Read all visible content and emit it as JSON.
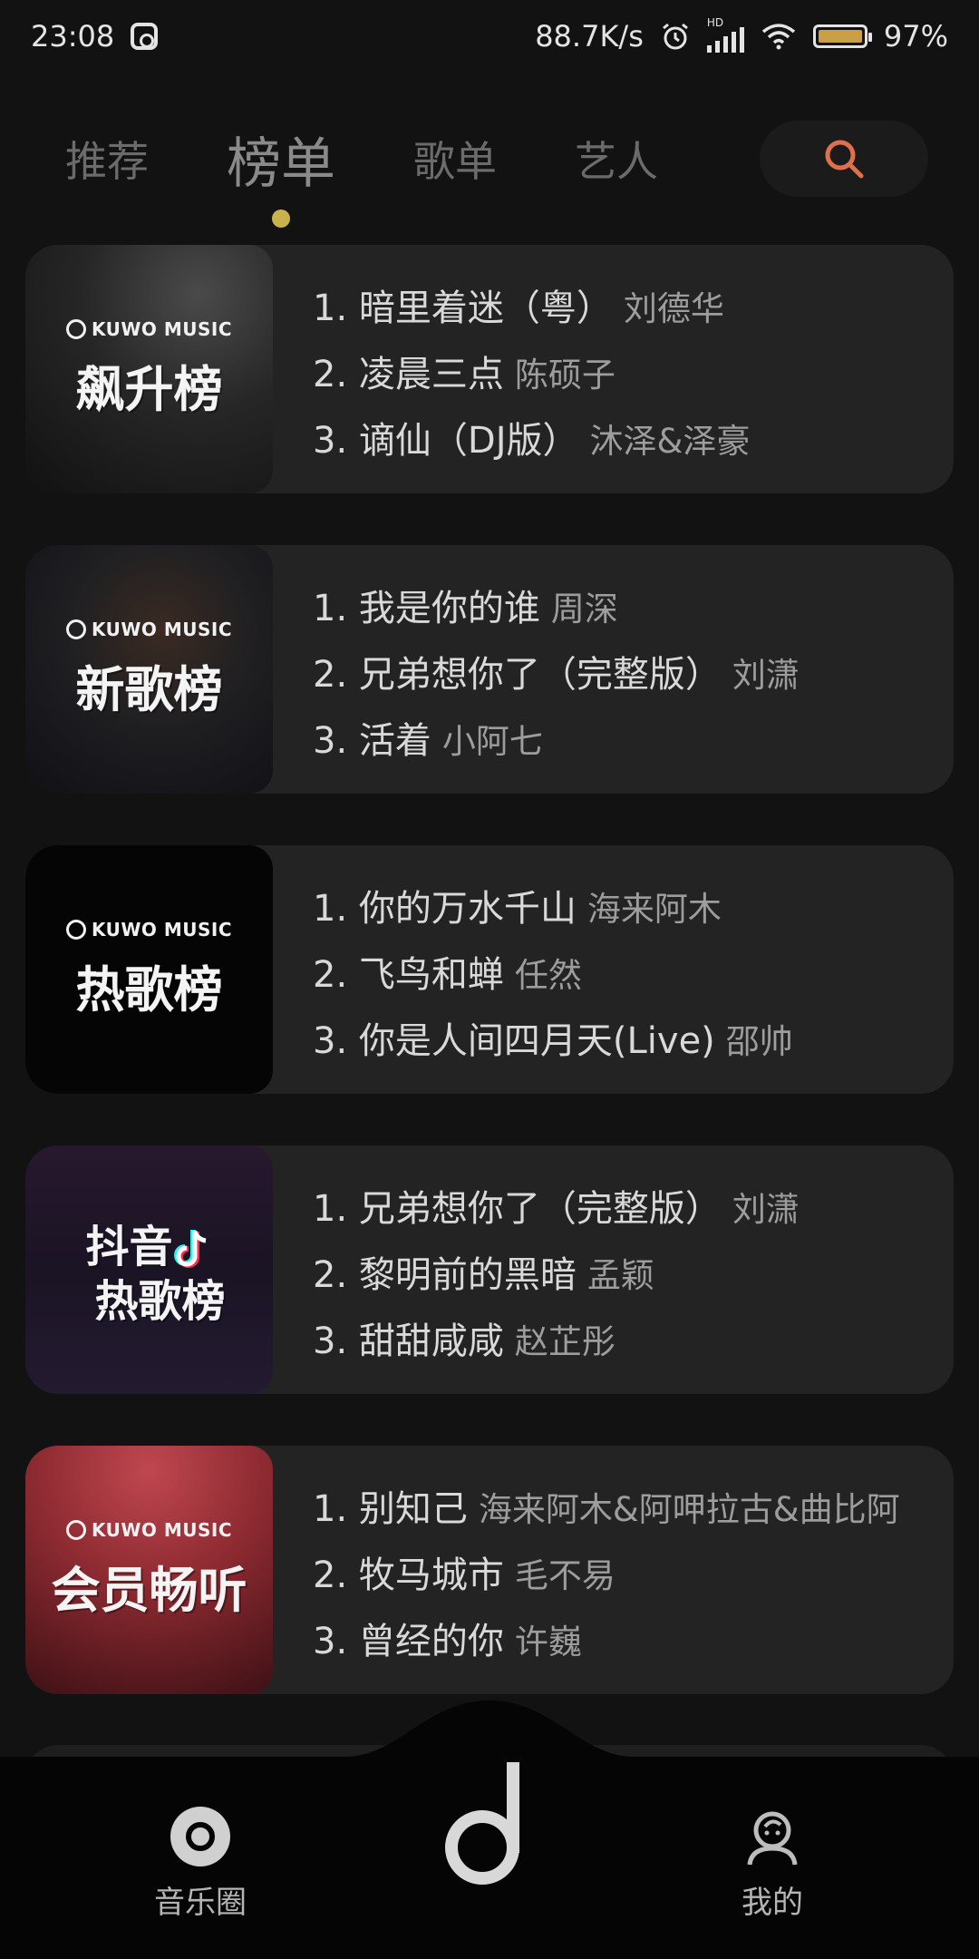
{
  "status_bar": {
    "time": "23:08",
    "net_speed": "88.7K/s",
    "battery": "97",
    "battery_symbol": "%",
    "hd_label": "HD",
    "icons": [
      "app-logo-icon",
      "alarm-icon",
      "signal-icon",
      "wifi-icon",
      "battery-icon"
    ]
  },
  "tabs": [
    {
      "label": "推荐"
    },
    {
      "label": "榜单",
      "active": true
    },
    {
      "label": "歌单"
    },
    {
      "label": "艺人"
    }
  ],
  "accent_color": "#e0704a",
  "indicator_color": "#c9b24b",
  "charts": [
    {
      "brand": "KUWO MUSIC",
      "cover_title": "飙升榜",
      "songs": [
        {
          "rank": "1.",
          "title": "暗里着迷（粤）",
          "artist": "刘德华"
        },
        {
          "rank": "2.",
          "title": "凌晨三点",
          "artist": "陈硕子"
        },
        {
          "rank": "3.",
          "title": "谪仙（DJ版）",
          "artist": "沐泽&泽豪"
        }
      ]
    },
    {
      "brand": "KUWO MUSIC",
      "cover_title": "新歌榜",
      "songs": [
        {
          "rank": "1.",
          "title": "我是你的谁",
          "artist": "周深"
        },
        {
          "rank": "2.",
          "title": "兄弟想你了（完整版）",
          "artist": "刘潇"
        },
        {
          "rank": "3.",
          "title": "活着",
          "artist": "小阿七"
        }
      ]
    },
    {
      "brand": "KUWO MUSIC",
      "cover_title": "热歌榜",
      "songs": [
        {
          "rank": "1.",
          "title": "你的万水千山",
          "artist": "海来阿木"
        },
        {
          "rank": "2.",
          "title": "飞鸟和蝉",
          "artist": "任然"
        },
        {
          "rank": "3.",
          "title": "你是人间四月天(Live)",
          "artist": "邵帅"
        }
      ]
    },
    {
      "brand": "",
      "cover_title_line1": "抖音",
      "cover_title_line2": "热歌榜",
      "songs": [
        {
          "rank": "1.",
          "title": "兄弟想你了（完整版）",
          "artist": "刘潇"
        },
        {
          "rank": "2.",
          "title": "黎明前的黑暗",
          "artist": "孟颖"
        },
        {
          "rank": "3.",
          "title": "甜甜咸咸",
          "artist": "赵芷彤"
        }
      ]
    },
    {
      "brand": "KUWO MUSIC",
      "cover_title": "会员畅听",
      "songs": [
        {
          "rank": "1.",
          "title": "别知己",
          "artist": "海来阿木&阿呷拉古&曲比阿"
        },
        {
          "rank": "2.",
          "title": "牧马城市",
          "artist": "毛不易"
        },
        {
          "rank": "3.",
          "title": "曾经的你",
          "artist": "许巍"
        }
      ]
    }
  ],
  "bottom_nav": {
    "left_label": "音乐圈",
    "right_label": "我的"
  }
}
